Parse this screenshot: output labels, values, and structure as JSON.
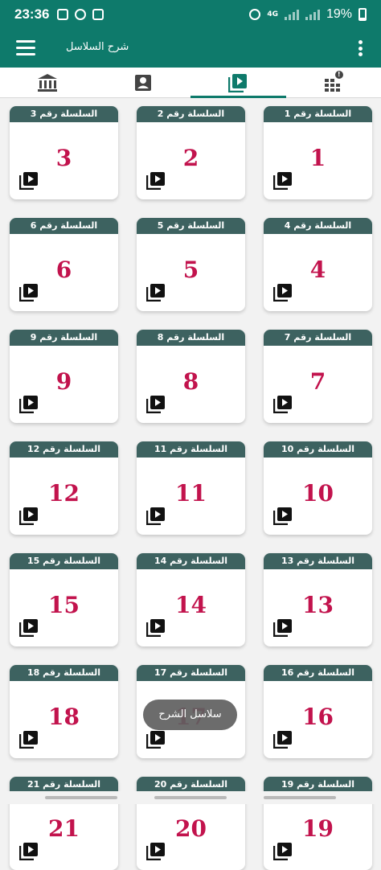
{
  "status_bar": {
    "time": "23:36",
    "network": "4G",
    "battery": "19%"
  },
  "app_bar": {
    "title": "شرح السلاسل"
  },
  "tabs": [
    {
      "icon": "library-icon",
      "active": false
    },
    {
      "icon": "contact-icon",
      "active": false
    },
    {
      "icon": "video-library-icon",
      "active": true
    },
    {
      "icon": "apps-icon",
      "active": false,
      "badge": "!"
    }
  ],
  "cards": [
    {
      "label": "السلسلة رقم 1",
      "number": "1"
    },
    {
      "label": "السلسلة رقم 2",
      "number": "2"
    },
    {
      "label": "السلسلة رقم 3",
      "number": "3"
    },
    {
      "label": "السلسلة رقم 4",
      "number": "4"
    },
    {
      "label": "السلسلة رقم 5",
      "number": "5"
    },
    {
      "label": "السلسلة رقم 6",
      "number": "6"
    },
    {
      "label": "السلسلة رقم 7",
      "number": "7"
    },
    {
      "label": "السلسلة رقم 8",
      "number": "8"
    },
    {
      "label": "السلسلة رقم 9",
      "number": "9"
    },
    {
      "label": "السلسلة رقم 10",
      "number": "10"
    },
    {
      "label": "السلسلة رقم 11",
      "number": "11"
    },
    {
      "label": "السلسلة رقم 12",
      "number": "12"
    },
    {
      "label": "السلسلة رقم 13",
      "number": "13"
    },
    {
      "label": "السلسلة رقم 14",
      "number": "14"
    },
    {
      "label": "السلسلة رقم 15",
      "number": "15"
    },
    {
      "label": "السلسلة رقم 16",
      "number": "16"
    },
    {
      "label": "السلسلة رقم 17",
      "number": "17"
    },
    {
      "label": "السلسلة رقم 18",
      "number": "18"
    },
    {
      "label": "السلسلة رقم 19",
      "number": "19"
    },
    {
      "label": "السلسلة رقم 20",
      "number": "20"
    },
    {
      "label": "السلسلة رقم 21",
      "number": "21"
    }
  ],
  "toast": {
    "text": "سلاسل الشرح"
  },
  "colors": {
    "primary": "#0e7a6b",
    "card_header": "#3d6260",
    "number": "#c2134d"
  }
}
